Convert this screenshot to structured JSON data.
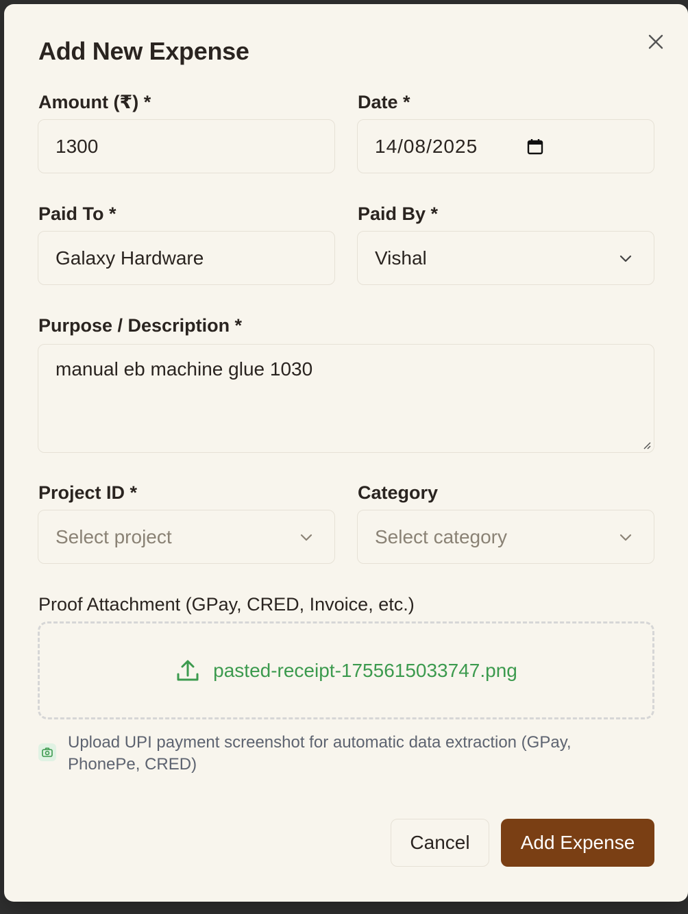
{
  "dialog": {
    "title": "Add New Expense",
    "close_icon": "close-icon"
  },
  "form": {
    "amount": {
      "label": "Amount (₹) *",
      "value": "1300"
    },
    "date": {
      "label": "Date *",
      "value": "14/08/2025",
      "icon": "calendar-icon"
    },
    "paid_to": {
      "label": "Paid To *",
      "value": "Galaxy Hardware"
    },
    "paid_by": {
      "label": "Paid By *",
      "value": "Vishal",
      "icon": "chevron-down-icon"
    },
    "purpose": {
      "label": "Purpose / Description *",
      "value": "manual eb machine glue 1030"
    },
    "project": {
      "label": "Project ID *",
      "placeholder": "Select project"
    },
    "category": {
      "label": "Category",
      "placeholder": "Select category"
    },
    "attachment": {
      "label": "Proof Attachment (GPay, CRED, Invoice, etc.)",
      "file_name": "pasted-receipt-1755615033747.png",
      "icon": "upload-icon"
    },
    "hint": {
      "icon": "camera-icon",
      "text": "Upload UPI payment screenshot for automatic data extraction (GPay, PhonePe, CRED)"
    }
  },
  "actions": {
    "cancel_label": "Cancel",
    "submit_label": "Add Expense"
  },
  "colors": {
    "modal_bg": "#f8f5ed",
    "primary_button": "#7a3f14",
    "file_text": "#3c9a4e",
    "text": "#2a2420"
  }
}
